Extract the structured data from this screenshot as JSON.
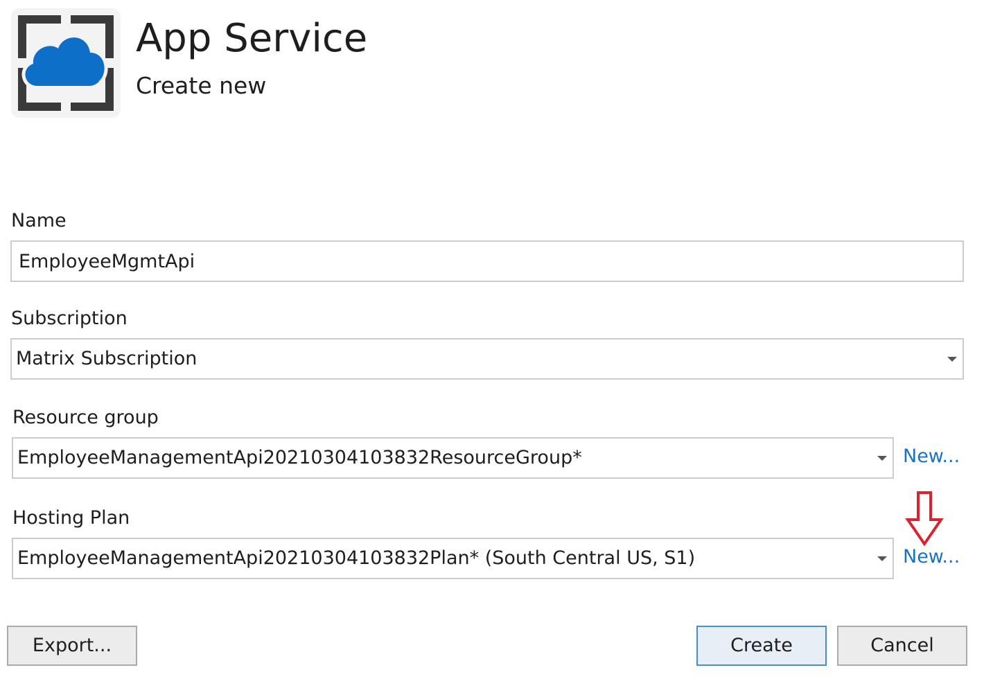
{
  "header": {
    "title": "App Service",
    "subtitle": "Create new",
    "logo_icon": "app-service-cloud-icon"
  },
  "form": {
    "name": {
      "label": "Name",
      "value": "EmployeeMgmtApi"
    },
    "subscription": {
      "label": "Subscription",
      "selected": "Matrix Subscription"
    },
    "resource_group": {
      "label": "Resource group",
      "selected": "EmployeeManagementApi20210304103832ResourceGroup*",
      "new_link": "New..."
    },
    "hosting_plan": {
      "label": "Hosting Plan",
      "selected": "EmployeeManagementApi20210304103832Plan* (South Central US, S1)",
      "new_link": "New..."
    }
  },
  "footer": {
    "export_label": "Export...",
    "create_label": "Create",
    "cancel_label": "Cancel"
  },
  "colors": {
    "link": "#1a73c2",
    "cloud": "#0e6fc9",
    "annotation_arrow": "#d9232e",
    "field_border": "#cccccc"
  },
  "icons": {
    "dropdown": "chevron-down-icon",
    "annotation": "arrow-down-icon"
  }
}
